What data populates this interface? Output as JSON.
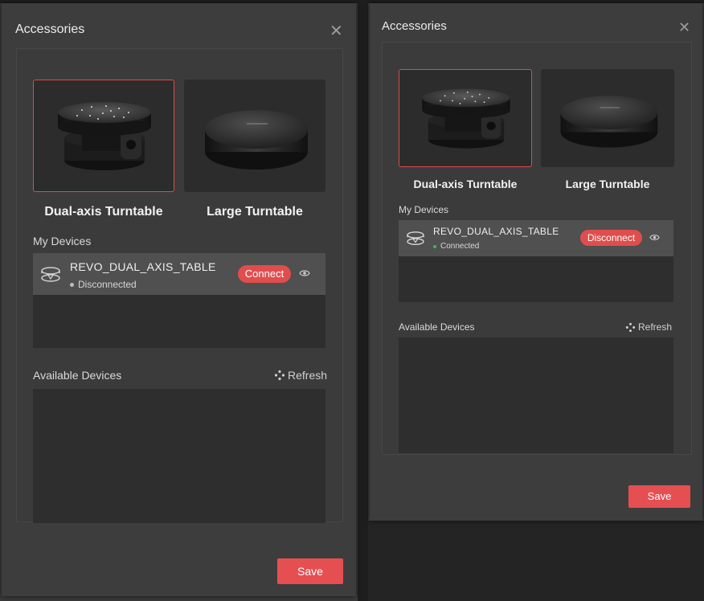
{
  "colors": {
    "accent": "#e54f52",
    "connected": "#3dbd4a",
    "disconnected": "#bdbdbd",
    "dialog_bg": "#3d3d3d"
  },
  "left": {
    "title": "Accessories",
    "cards": [
      {
        "label": "Dual-axis Turntable",
        "selected": true,
        "icon": "dual-axis-turntable-image"
      },
      {
        "label": "Large Turntable",
        "selected": false,
        "icon": "large-turntable-image"
      }
    ],
    "my_devices_label": "My Devices",
    "device": {
      "name": "REVO_DUAL_AXIS_TABLE",
      "status": "Disconnected",
      "action": "Connect"
    },
    "available_label": "Available Devices",
    "refresh_label": "Refresh",
    "save_label": "Save"
  },
  "right": {
    "title": "Accessories",
    "cards": [
      {
        "label": "Dual-axis Turntable",
        "selected": true,
        "icon": "dual-axis-turntable-image"
      },
      {
        "label": "Large Turntable",
        "selected": false,
        "icon": "large-turntable-image"
      }
    ],
    "my_devices_label": "My Devices",
    "device": {
      "name": "REVO_DUAL_AXIS_TABLE",
      "status": "Connected",
      "action": "Disconnect"
    },
    "available_label": "Available Devices",
    "refresh_label": "Refresh",
    "save_label": "Save"
  }
}
